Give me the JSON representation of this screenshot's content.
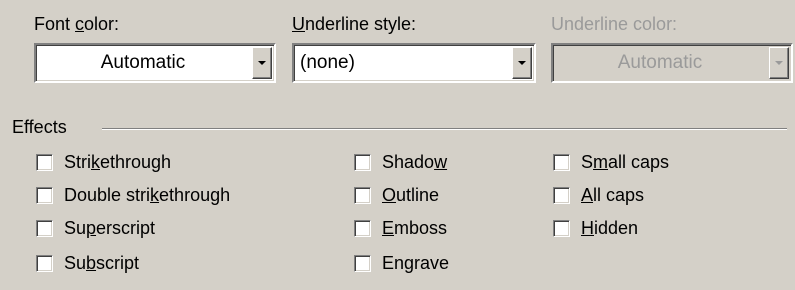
{
  "font_color": {
    "label_before": "Font ",
    "label_key": "c",
    "label_after": "olor:",
    "value": "Automatic",
    "dropdown_icon": "chevron-down-icon"
  },
  "underline_style": {
    "label_before": "",
    "label_key": "U",
    "label_after": "nderline style:",
    "value": "(none)",
    "dropdown_icon": "chevron-down-icon"
  },
  "underline_color": {
    "label": "Underline color:",
    "value": "Automatic",
    "dropdown_icon": "chevron-down-icon",
    "disabled": true
  },
  "effects": {
    "title": "Effects",
    "options": [
      {
        "before": "Stri",
        "key": "k",
        "after": "ethrough",
        "checked": false
      },
      {
        "before": "Double stri",
        "key": "k",
        "after": "ethrough",
        "checked": false
      },
      {
        "before": "Su",
        "key": "p",
        "after": "erscript",
        "checked": false
      },
      {
        "before": "Su",
        "key": "b",
        "after": "script",
        "checked": false
      },
      {
        "before": "Shado",
        "key": "w",
        "after": "",
        "checked": false
      },
      {
        "before": "",
        "key": "O",
        "after": "utline",
        "checked": false
      },
      {
        "before": "",
        "key": "E",
        "after": "mboss",
        "checked": false
      },
      {
        "before": "En",
        "key": "g",
        "after": "rave",
        "checked": false
      },
      {
        "before": "S",
        "key": "m",
        "after": "all caps",
        "checked": false
      },
      {
        "before": "",
        "key": "A",
        "after": "ll caps",
        "checked": false
      },
      {
        "before": "",
        "key": "H",
        "after": "idden",
        "checked": false
      }
    ]
  },
  "colors": {
    "dialog_background": "#d4d0c8",
    "field_background": "#ffffff",
    "disabled_text": "#9a9a9a",
    "shadow": "#808080",
    "highlight": "#ffffff"
  }
}
